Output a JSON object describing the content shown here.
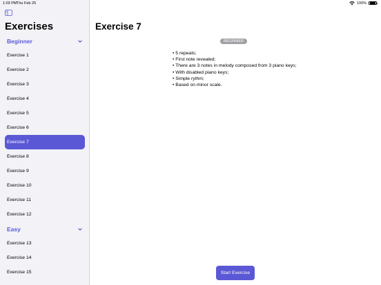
{
  "status_bar": {
    "time": "1:03 PM",
    "date": "Thu Feb 25",
    "battery": "100%",
    "battery_level": 1.0
  },
  "sidebar": {
    "title": "Exercises",
    "sections": [
      {
        "label": "Beginner",
        "items": [
          "Exercise 1",
          "Exercise 2",
          "Exercise 3",
          "Exercise 4",
          "Exercise 5",
          "Exercise 6",
          "Exercise 7",
          "Exercise 8",
          "Exercise 9",
          "Exercise 10",
          "Exercise 11",
          "Exercise 12"
        ]
      },
      {
        "label": "Easy",
        "items": [
          "Exercise 13",
          "Exercise 14",
          "Exercise 15"
        ]
      }
    ],
    "selected": "Exercise 7"
  },
  "main": {
    "title": "Exercise 7",
    "level_badge": "BEGINNER",
    "details": [
      "5 repeats;",
      "First note revealed;",
      "There are 3 notes in melody composed from 3 piano keys;",
      "With disabled piano keys;",
      "Simple rythm;",
      "Based on minor scale."
    ],
    "start_button": "Start Exercise"
  },
  "colors": {
    "accent": "#5b58d6",
    "sidebar_bg": "#f2f2f7",
    "badge_bg": "#a0a0a5"
  }
}
